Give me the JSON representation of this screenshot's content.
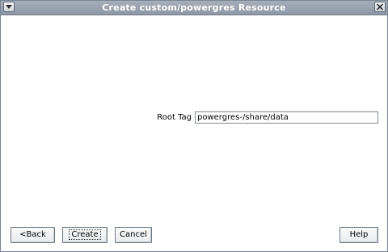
{
  "window": {
    "title": "Create custom/powergres Resource"
  },
  "form": {
    "root_tag_label": "Root Tag",
    "root_tag_value": "powergres-/share/data"
  },
  "buttons": {
    "back": "<Back",
    "create": "Create",
    "cancel": "Cancel",
    "help": "Help"
  },
  "icons": {
    "window_menu": "window-menu-icon",
    "close": "close-icon"
  }
}
